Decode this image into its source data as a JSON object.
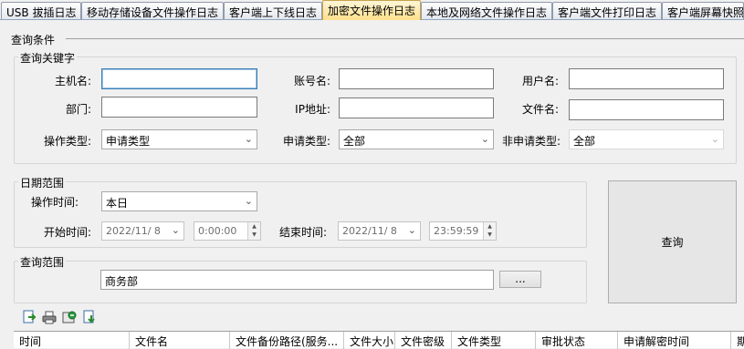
{
  "tabs": [
    {
      "label": "USB 拔插日志",
      "active": false
    },
    {
      "label": "移动存储设备文件操作日志",
      "active": false
    },
    {
      "label": "客户端上下线日志",
      "active": false
    },
    {
      "label": "加密文件操作日志",
      "active": true
    },
    {
      "label": "本地及网络文件操作日志",
      "active": false
    },
    {
      "label": "客户端文件打印日志",
      "active": false
    },
    {
      "label": "客户端屏幕快照",
      "active": false
    }
  ],
  "query_conditions": {
    "title": "查询条件",
    "keywords": {
      "title": "查询关键字",
      "hostname_label": "主机名:",
      "hostname_value": "",
      "account_label": "账号名:",
      "account_value": "",
      "username_label": "用户名:",
      "username_value": "",
      "dept_label": "部门:",
      "dept_value": "",
      "ip_label": "IP地址:",
      "ip_value": "",
      "filename_label": "文件名:",
      "filename_value": "",
      "optype_label": "操作类型:",
      "optype_value": "申请类型",
      "applytype_label": "申请类型:",
      "applytype_value": "全部",
      "nonapply_label": "非申请类型:",
      "nonapply_value": "全部"
    },
    "date_range": {
      "title": "日期范围",
      "optime_label": "操作时间:",
      "optime_value": "本日",
      "start_label": "开始时间:",
      "start_date": "2022/11/ 8",
      "start_time": "0:00:00",
      "end_label": "结束时间:",
      "end_date": "2022/11/ 8",
      "end_time": "23:59:59"
    },
    "scope": {
      "title": "查询范围",
      "value": "商务部",
      "browse_label": "..."
    },
    "query_button": "查询"
  },
  "toolbar": {
    "icons": [
      "export-icon",
      "print-icon",
      "refresh-icon",
      "download-icon"
    ]
  },
  "grid": {
    "columns": [
      "时间",
      "文件名",
      "文件备份路径(服务...",
      "文件大小",
      "文件密级",
      "文件类型",
      "审批状态",
      "申请解密时间",
      "期"
    ]
  }
}
